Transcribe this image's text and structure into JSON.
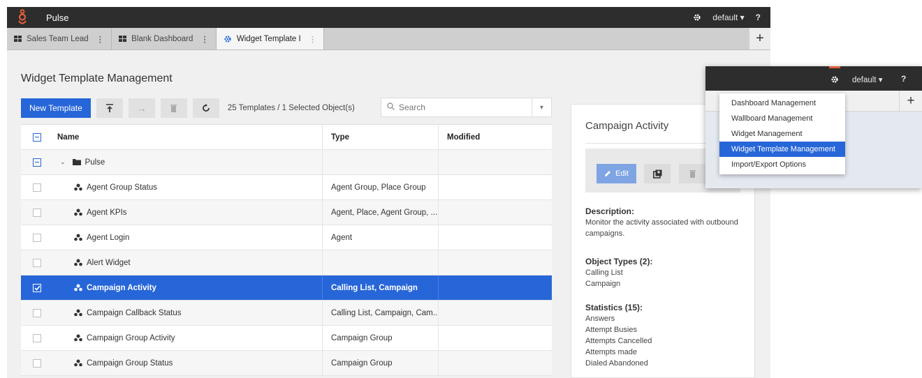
{
  "app": {
    "title": "Pulse"
  },
  "topbar": {
    "user": "default ▾",
    "help": "?"
  },
  "tabs": [
    {
      "label": "Sales Team Lead",
      "icon": "dashboard-grid-icon"
    },
    {
      "label": "Blank Dashboard",
      "icon": "dashboard-grid-icon"
    },
    {
      "label": "Widget Template I",
      "icon": "gear-icon"
    }
  ],
  "page": {
    "title": "Widget Template Management"
  },
  "toolbar": {
    "new_template": "New Template",
    "count_text": "25 Templates / 1 Selected Object(s)"
  },
  "search": {
    "placeholder": "Search"
  },
  "table": {
    "columns": {
      "name": "Name",
      "type": "Type",
      "modified": "Modified"
    },
    "rows": [
      {
        "name": "Pulse",
        "type": "",
        "modified": ""
      },
      {
        "name": "Agent Group Status",
        "type": "Agent Group, Place Group",
        "modified": ""
      },
      {
        "name": "Agent KPIs",
        "type": "Agent, Place, Agent Group, ...",
        "modified": ""
      },
      {
        "name": "Agent Login",
        "type": "Agent",
        "modified": ""
      },
      {
        "name": "Alert Widget",
        "type": "",
        "modified": ""
      },
      {
        "name": "Campaign Activity",
        "type": "Calling List, Campaign",
        "modified": ""
      },
      {
        "name": "Campaign Callback Status",
        "type": "Calling List, Campaign, Cam...",
        "modified": ""
      },
      {
        "name": "Campaign Group Activity",
        "type": "Campaign Group",
        "modified": ""
      },
      {
        "name": "Campaign Group Status",
        "type": "Campaign Group",
        "modified": ""
      }
    ]
  },
  "details": {
    "title": "Campaign Activity",
    "edit": "Edit",
    "description_heading": "Description:",
    "description": "Monitor the activity associated with outbound campaigns.",
    "object_types_heading": "Object Types (2):",
    "object_types": [
      "Calling List",
      "Campaign"
    ],
    "statistics_heading": "Statistics (15):",
    "statistics": [
      "Answers",
      "Attempt Busies",
      "Attempts Cancelled",
      "Attempts made",
      "Dialed Abandoned"
    ]
  },
  "overlay": {
    "user": "default ▾",
    "help": "?",
    "menu": [
      "Dashboard Management",
      "Wallboard Management",
      "Widget Management",
      "Widget Template Management",
      "Import/Export Options"
    ]
  },
  "colors": {
    "accent": "#2766d8",
    "topbar": "#2d2d2d",
    "logo": "#e05d3a"
  }
}
